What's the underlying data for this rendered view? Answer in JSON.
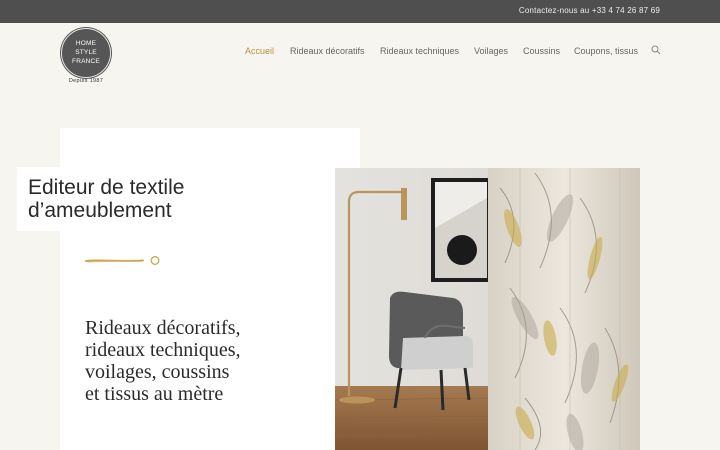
{
  "topbar": {
    "contact": "Contactez-nous au +33 4 74 26 87 69"
  },
  "logo": {
    "line1": "HOME",
    "line2": "STYLE",
    "line3": "FRANCE",
    "tagline": "Depuis 1987"
  },
  "nav": {
    "items": [
      {
        "label": "Accueil",
        "active": true
      },
      {
        "label": "Rideaux décoratifs",
        "active": false
      },
      {
        "label": "Rideaux techniques",
        "active": false
      },
      {
        "label": "Voilages",
        "active": false
      },
      {
        "label": "Coussins",
        "active": false
      },
      {
        "label": "Coupons, tissus",
        "active": false
      }
    ],
    "accent": "#b8943f"
  },
  "hero": {
    "title_line1": "Editeur de textile",
    "title_line2": "d’ameublement",
    "subtitle_line1": "Rideaux décoratifs,",
    "subtitle_line2": "rideaux techniques,",
    "subtitle_line3": "voilages, coussins",
    "subtitle_line4": "et tissus au mètre"
  },
  "icons": {
    "search": "search-icon",
    "divider": "gold-brushstroke-icon"
  }
}
